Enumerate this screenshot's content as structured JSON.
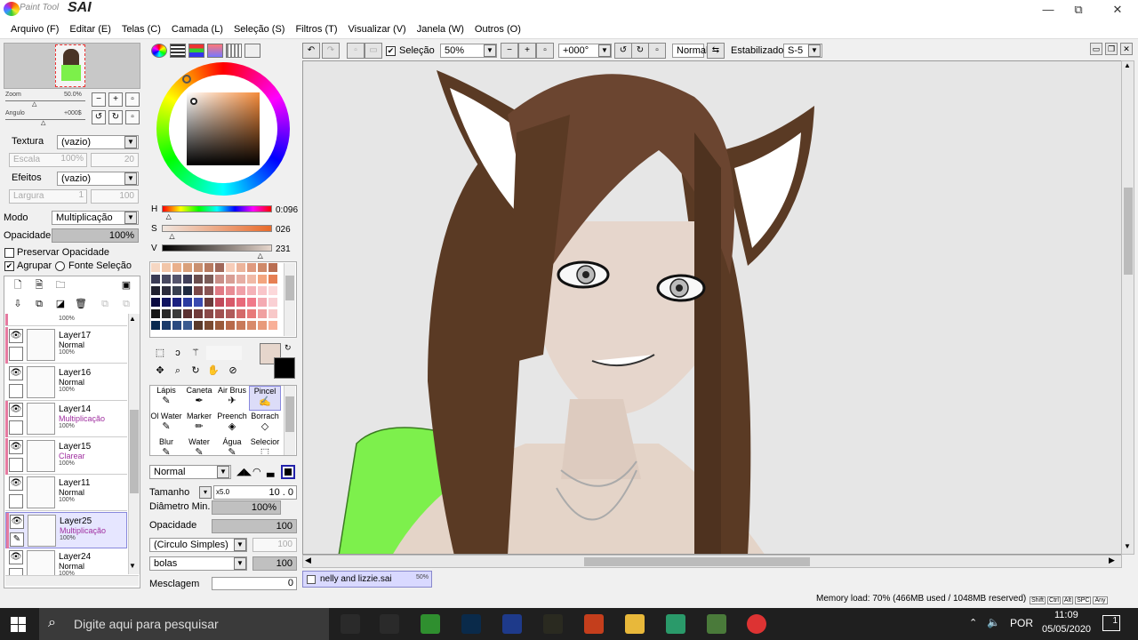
{
  "app": {
    "logo_small": "Paint Tool",
    "logo_big": "SAI",
    "window_controls": {
      "minimize": "—",
      "maximize": "⧉",
      "close": "✕"
    }
  },
  "menu": [
    "Arquivo (F)",
    "Editar (E)",
    "Telas (C)",
    "Camada (L)",
    "Seleção (S)",
    "Filtros (T)",
    "Visualizar (V)",
    "Janela (W)",
    "Outros (O)"
  ],
  "navigator": {
    "zoom_label": "Zoom",
    "zoom_value": "50.0%",
    "angle_label": "Angulo",
    "angle_value": "+000$"
  },
  "layer_props": {
    "texture_label": "Textura",
    "texture_value": "(vazio)",
    "scale_label": "Escala",
    "scale_value": "100%",
    "scale_num": "20",
    "effects_label": "Efeitos",
    "effects_value": "(vazio)",
    "width_label": "Largura",
    "width_value": "1",
    "width_num": "100",
    "mode_label": "Modo",
    "mode_value": "Multiplicação",
    "opacity_label": "Opacidade",
    "opacity_value": "100%",
    "opacity_fraction": 1.0,
    "preserve_opacity": "Preservar Opacidade",
    "group_label": "Agrupar",
    "source_label": "Fonte Seleção"
  },
  "layers": [
    {
      "name": "Layer17",
      "mode": "Normal",
      "opacity": "100%",
      "selected": false,
      "pink": true,
      "blend": "normal"
    },
    {
      "name": "Layer16",
      "mode": "Normal",
      "opacity": "100%",
      "selected": false,
      "pink": false,
      "blend": "normal"
    },
    {
      "name": "Layer14",
      "mode": "Multiplicação",
      "opacity": "100%",
      "selected": false,
      "pink": true,
      "blend": "special"
    },
    {
      "name": "Layer15",
      "mode": "Clarear",
      "opacity": "100%",
      "selected": false,
      "pink": true,
      "blend": "special"
    },
    {
      "name": "Layer11",
      "mode": "Normal",
      "opacity": "100%",
      "selected": false,
      "pink": false,
      "blend": "normal"
    },
    {
      "name": "Layer25",
      "mode": "Multiplicação",
      "opacity": "100%",
      "selected": true,
      "pink": true,
      "blend": "special"
    },
    {
      "name": "Layer24",
      "mode": "Normal",
      "opacity": "100%",
      "selected": false,
      "pink": false,
      "blend": "normal"
    }
  ],
  "layer_top_partial_opacity": "100%",
  "color": {
    "h_label": "H",
    "h_value": "0:096",
    "h_fraction": 0.07,
    "s_label": "S",
    "s_value": "026",
    "s_fraction": 0.1,
    "v_label": "V",
    "v_value": "231",
    "v_fraction": 0.9,
    "primary": "#e6d6cc",
    "secondary": "#000000"
  },
  "swatches": [
    "#f6d7c3",
    "#f2c6a9",
    "#e9b08c",
    "#d9a07a",
    "#c99070",
    "#b77a60",
    "#a0685a",
    "#f7cdb9",
    "#ecb49b",
    "#df9a7f",
    "#cf8969",
    "#b96e52",
    "#3b3b55",
    "#484860",
    "#55556d",
    "#40405a",
    "#6a4e4e",
    "#7b5c58",
    "#c98f88",
    "#d89e95",
    "#e7aea4",
    "#f0b9a6",
    "#f3a57e",
    "#e67f53",
    "#20202e",
    "#2c2c3c",
    "#384050",
    "#1e2a40",
    "#7a4848",
    "#8a5454",
    "#e07a84",
    "#e88c94",
    "#f0a0a8",
    "#f4b2b8",
    "#f9c5c9",
    "#fcd8da",
    "#0a0a40",
    "#101460",
    "#1a2080",
    "#2a3aa0",
    "#3a4ab0",
    "#6a3a3a",
    "#c04a5a",
    "#d85a6a",
    "#e86a7a",
    "#f07a8a",
    "#f4aab2",
    "#fad0d4",
    "#141414",
    "#2a2a2a",
    "#3a3a3a",
    "#5a3030",
    "#703a3a",
    "#8a4848",
    "#a05050",
    "#b05a5a",
    "#d46a6a",
    "#e87a7a",
    "#f0a0a0",
    "#f8c8c8",
    "#0a2a50",
    "#1a3a6a",
    "#2a4a80",
    "#3a5a90",
    "#5a3a2a",
    "#7a4a30",
    "#9a5a3a",
    "#b86a4a",
    "#c87a5a",
    "#d88a6a",
    "#e89a7a",
    "#f8b098"
  ],
  "tools": [
    {
      "label": "Lápis",
      "glyph": "✎"
    },
    {
      "label": "Caneta",
      "glyph": "✒"
    },
    {
      "label": "Air Brus",
      "glyph": "✈"
    },
    {
      "label": "Pincel",
      "glyph": "✍",
      "active": true
    },
    {
      "label": "Ol Water",
      "glyph": "✎"
    },
    {
      "label": "Marker",
      "glyph": "✏"
    },
    {
      "label": "Preench",
      "glyph": "◈"
    },
    {
      "label": "Borrach",
      "glyph": "◇"
    },
    {
      "label": "Blur",
      "glyph": "✎"
    },
    {
      "label": "Water",
      "glyph": "✎"
    },
    {
      "label": "Água",
      "glyph": "✎"
    },
    {
      "label": "Selecior",
      "glyph": "⬚"
    }
  ],
  "brush": {
    "mode_value": "Normal",
    "size_label": "Tamanho",
    "size_mult": "x5.0",
    "size_value": "10 . 0",
    "min_diam_label": "Diâmetro Min.",
    "min_diam_value": "100%",
    "min_diam_fraction": 1.0,
    "density_label": "Opacidade",
    "density_value": "100",
    "density_fraction": 1.0,
    "shape_value": "(Circulo Simples)",
    "shape_num": "100",
    "texture_value": "bolas",
    "texture_num": "100",
    "blend_label": "Mesclagem",
    "blend_value": "0"
  },
  "toolbar": {
    "selection_label": "Seleção",
    "zoom_value": "50%",
    "angle_value": "+000°",
    "mode_value": "Normal",
    "stabilizer_label": "Estabilizador",
    "stabilizer_value": "S-5"
  },
  "document": {
    "name": "nelly and lizzie.sai",
    "zoom": "50%"
  },
  "status": {
    "memory": "Memory load: 70% (466MB used / 1048MB reserved)",
    "keys": [
      "Shift",
      "Ctrl",
      "Alt",
      "SPC",
      "Any"
    ]
  },
  "taskbar": {
    "search_placeholder": "Digite aqui para pesquisar",
    "lang": "POR",
    "time": "11:09",
    "date": "05/05/2020",
    "notif": "1",
    "apps": [
      {
        "name": "unity-icon",
        "color": "#2a2a2a"
      },
      {
        "name": "osu-icon",
        "color": "#2a2a2a"
      },
      {
        "name": "xbox-icon",
        "color": "#2f8f2f"
      },
      {
        "name": "photoshop-icon",
        "color": "#0a2a4a"
      },
      {
        "name": "medibang-icon",
        "color": "#1e3a8a"
      },
      {
        "name": "league-icon",
        "color": "#2a2a20"
      },
      {
        "name": "powerpoint-icon",
        "color": "#c43e1c"
      },
      {
        "name": "explorer-icon",
        "color": "#e8b83a"
      },
      {
        "name": "minecraft-icon",
        "color": "#2a9a6a"
      },
      {
        "name": "sai-icon",
        "color": "#4a7a3a"
      },
      {
        "name": "chrome-icon",
        "color": "#d33"
      }
    ]
  }
}
